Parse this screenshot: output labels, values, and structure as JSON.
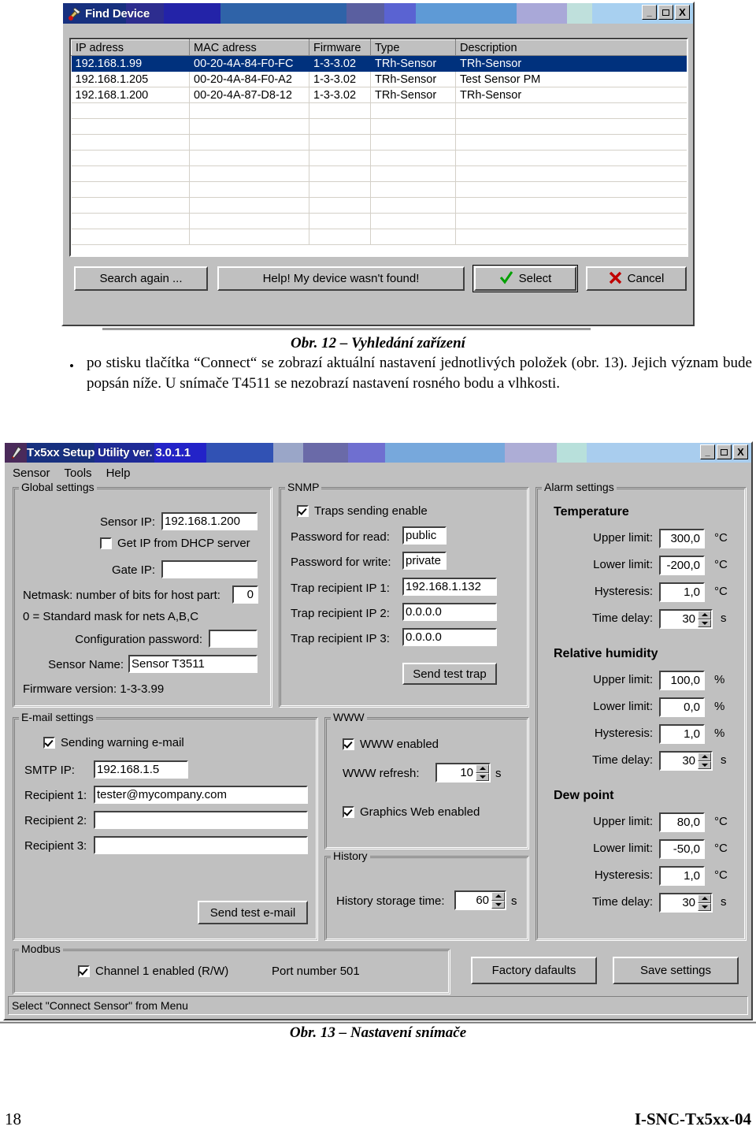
{
  "find_device": {
    "title": "Find Device",
    "icon": "hammer-tool-icon",
    "window_buttons": {
      "minimize": "_",
      "maximize": "❐",
      "close": "X"
    },
    "columns": [
      "IP adress",
      "MAC adress",
      "Firmware",
      "Type",
      "Description"
    ],
    "rows": [
      {
        "ip": "192.168.1.99",
        "mac": "00-20-4A-84-F0-FC",
        "firmware": "1-3-3.02",
        "type": "TRh-Sensor",
        "description": "TRh-Sensor",
        "selected": true
      },
      {
        "ip": "192.168.1.205",
        "mac": "00-20-4A-84-F0-A2",
        "firmware": "1-3-3.02",
        "type": "TRh-Sensor",
        "description": "Test Sensor PM",
        "selected": false
      },
      {
        "ip": "192.168.1.200",
        "mac": "00-20-4A-87-D8-12",
        "firmware": "1-3-3.02",
        "type": "TRh-Sensor",
        "description": "TRh-Sensor",
        "selected": false
      }
    ],
    "empty_row_count": 9,
    "buttons": {
      "search_again": "Search again ...",
      "help_not_found": "Help! My device wasn't found!",
      "select": "Select",
      "cancel": "Cancel"
    }
  },
  "doc": {
    "caption_12": "Obr. 12 – Vyhledání zařízení",
    "bullet": "•",
    "paragraph": "po stisku tlačítka “Connect“ se zobrazí aktuální nastavení jednotlivých položek (obr. 13). Jejich význam bude popsán níže. U snímače T4511 se nezobrazí nastavení rosného bodu a vlhkosti.",
    "caption_13": "Obr. 13 – Nastavení snímače",
    "page_number": "18",
    "doc_code": "I-SNC-Tx5xx-04"
  },
  "setup": {
    "title": "Tx5xx Setup Utility ver. 3.0.1.1",
    "icon": "screwdriver-tool-icon",
    "window_buttons": {
      "minimize": "_",
      "maximize": "❐",
      "close": "X"
    },
    "menu": [
      "Sensor",
      "Tools",
      "Help"
    ],
    "status": "Select \"Connect Sensor\" from Menu",
    "global": {
      "legend": "Global settings",
      "sensor_ip_label": "Sensor IP:",
      "sensor_ip_value": "192.168.1.200",
      "dhcp_label": "Get IP from DHCP server",
      "dhcp_checked": false,
      "gate_ip_label": "Gate IP:",
      "gate_ip_value": "",
      "netmask_label": "Netmask: number of bits for host part:",
      "netmask_value": "0",
      "netmask_hint": "0 = Standard mask for nets A,B,C",
      "config_pw_label": "Configuration password:",
      "config_pw_value": "",
      "sensor_name_label": "Sensor Name:",
      "sensor_name_value": "Sensor T3511",
      "firmware": "Firmware version: 1-3-3.99"
    },
    "snmp": {
      "legend": "SNMP",
      "traps_label": "Traps sending enable",
      "traps_checked": true,
      "pw_read_label": "Password for read:",
      "pw_read_value": "public",
      "pw_write_label": "Password for write:",
      "pw_write_value": "private",
      "trap1_label": "Trap recipient IP 1:",
      "trap1_value": "192.168.1.132",
      "trap2_label": "Trap recipient IP 2:",
      "trap2_value": "0.0.0.0",
      "trap3_label": "Trap recipient IP 3:",
      "trap3_value": "0.0.0.0",
      "send_test_trap": "Send test trap"
    },
    "alarm": {
      "legend": "Alarm settings",
      "groups": [
        {
          "title": "Temperature",
          "upper_label": "Upper limit:",
          "upper_value": "300,0",
          "upper_unit": "°C",
          "lower_label": "Lower limit:",
          "lower_value": "-200,0",
          "lower_unit": "°C",
          "hyst_label": "Hysteresis:",
          "hyst_value": "1,0",
          "hyst_unit": "°C",
          "delay_label": "Time delay:",
          "delay_value": "30",
          "delay_unit": "s"
        },
        {
          "title": "Relative humidity",
          "upper_label": "Upper limit:",
          "upper_value": "100,0",
          "upper_unit": "%",
          "lower_label": "Lower limit:",
          "lower_value": "0,0",
          "lower_unit": "%",
          "hyst_label": "Hysteresis:",
          "hyst_value": "1,0",
          "hyst_unit": "%",
          "delay_label": "Time delay:",
          "delay_value": "30",
          "delay_unit": "s"
        },
        {
          "title": "Dew point",
          "upper_label": "Upper limit:",
          "upper_value": "80,0",
          "upper_unit": "°C",
          "lower_label": "Lower limit:",
          "lower_value": "-50,0",
          "lower_unit": "°C",
          "hyst_label": "Hysteresis:",
          "hyst_value": "1,0",
          "hyst_unit": "°C",
          "delay_label": "Time delay:",
          "delay_value": "30",
          "delay_unit": "s"
        }
      ]
    },
    "email": {
      "legend": "E-mail settings",
      "warning_label": "Sending warning e-mail",
      "warning_checked": true,
      "smtp_label": "SMTP IP:",
      "smtp_value": "192.168.1.5",
      "rcpt1_label": "Recipient 1:",
      "rcpt1_value": "tester@mycompany.com",
      "rcpt2_label": "Recipient 2:",
      "rcpt2_value": "",
      "rcpt3_label": "Recipient 3:",
      "rcpt3_value": "",
      "send_test_email": "Send test e-mail"
    },
    "www": {
      "legend": "WWW",
      "enabled_label": "WWW enabled",
      "enabled_checked": true,
      "refresh_label": "WWW refresh:",
      "refresh_value": "10",
      "refresh_unit": "s",
      "graphics_label": "Graphics Web enabled",
      "graphics_checked": true
    },
    "history": {
      "legend": "History",
      "storage_label": "History storage time:",
      "storage_value": "60",
      "storage_unit": "s"
    },
    "modbus": {
      "legend": "Modbus",
      "channel_label": "Channel 1 enabled (R/W)",
      "channel_checked": true,
      "port_label": "Port number 501"
    },
    "actions": {
      "factory_defaults": "Factory dafaults",
      "save_settings": "Save settings"
    }
  },
  "colors": {
    "face": "#c0c0c0",
    "selection": "#00317d",
    "title_blue": "#17307f",
    "check_green": "#00a000",
    "cancel_red": "#c00000"
  }
}
